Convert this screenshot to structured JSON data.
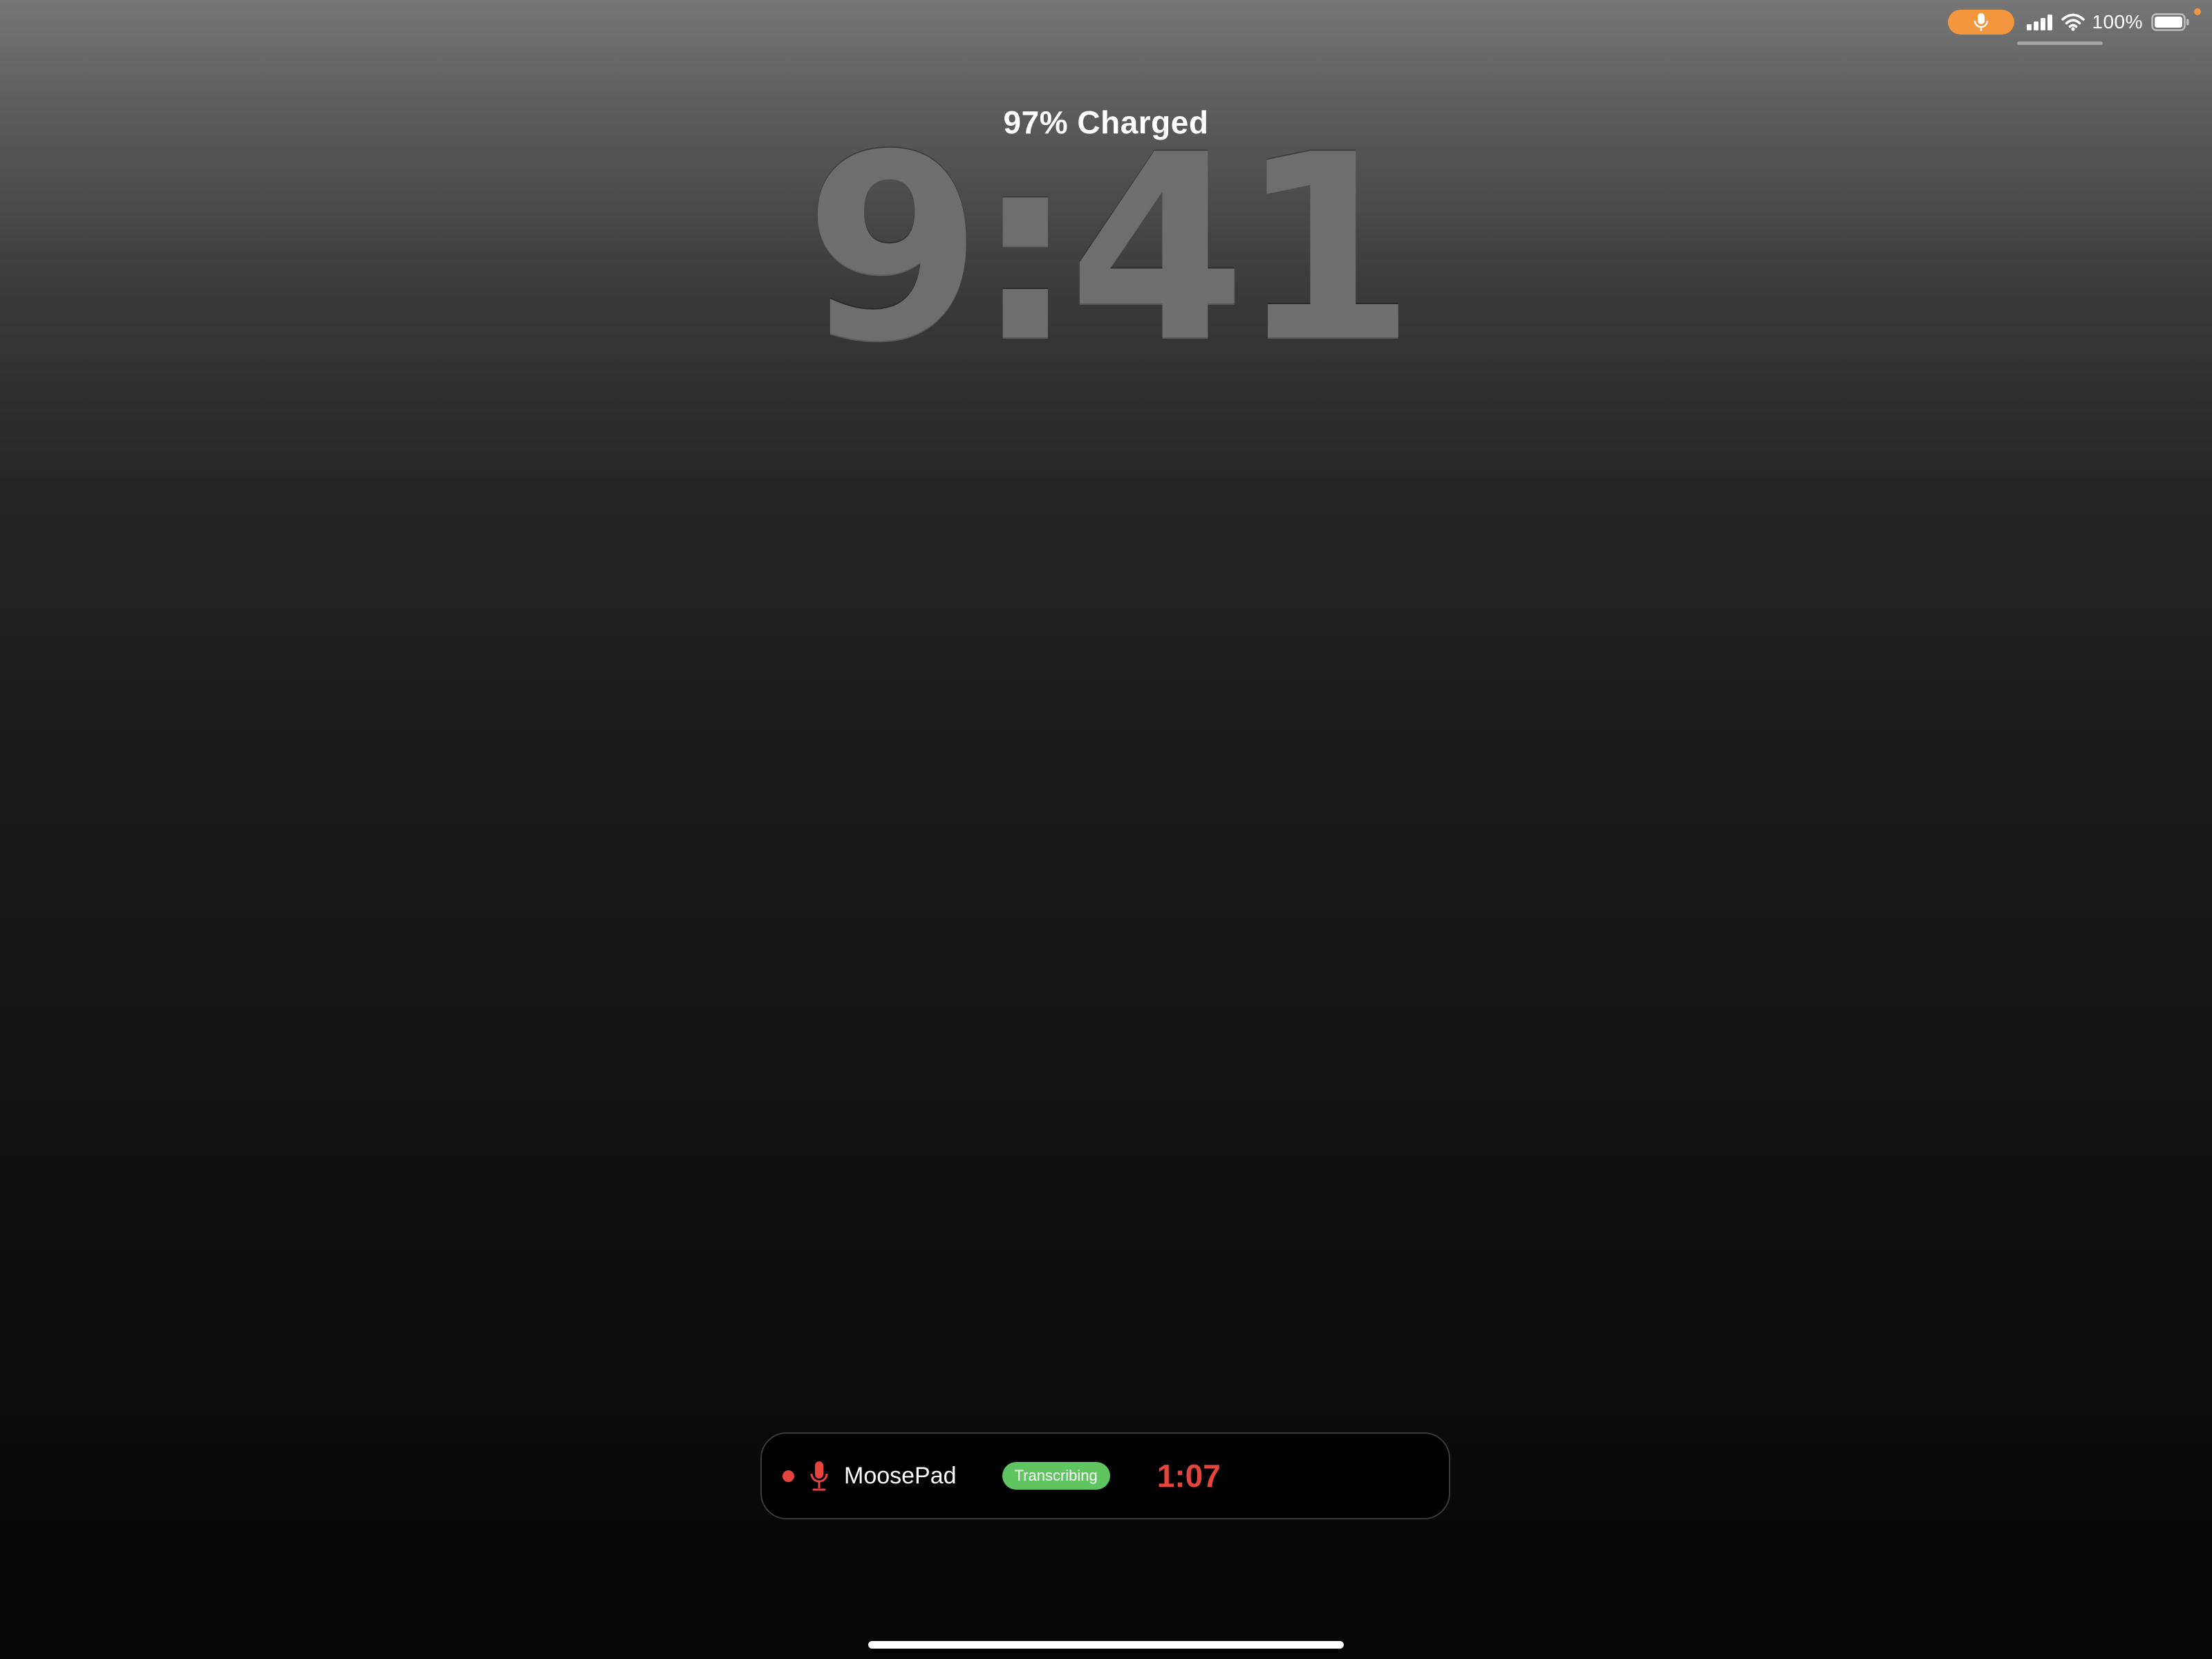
{
  "status_bar": {
    "battery_percent": "100%",
    "mic_indicator_color": "#f4963e",
    "icons": [
      "microphone-icon",
      "cellular-signal-icon",
      "wifi-icon",
      "battery-icon"
    ]
  },
  "lock_screen": {
    "charge_status": "97% Charged",
    "time": "9:41"
  },
  "live_activity": {
    "app_name": "MoosePad",
    "status_badge": "Transcribing",
    "elapsed_time": "1:07",
    "accent_color": "#e5453d",
    "badge_color": "#5fc561",
    "icons": [
      "recording-dot-icon",
      "microphone-icon"
    ]
  }
}
